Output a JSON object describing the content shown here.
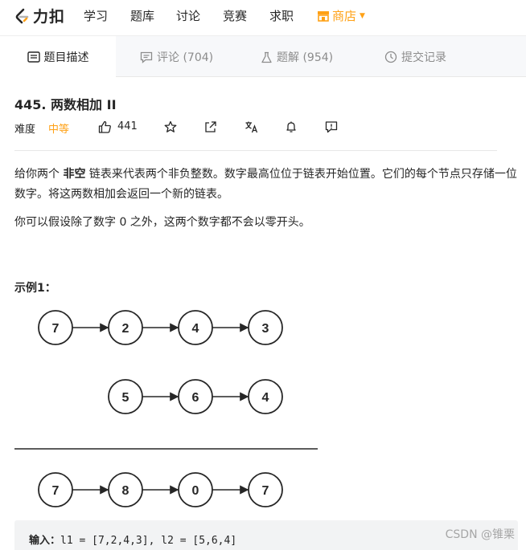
{
  "nav": {
    "logo_text": "力扣",
    "links": [
      "学习",
      "题库",
      "讨论",
      "竞赛",
      "求职"
    ],
    "store_label": "商店"
  },
  "tabs": [
    {
      "label": "题目描述",
      "icon": "description-icon",
      "active": true
    },
    {
      "label": "评论 (704)",
      "icon": "comment-icon",
      "active": false
    },
    {
      "label": "题解 (954)",
      "icon": "flask-icon",
      "active": false
    },
    {
      "label": "提交记录",
      "icon": "clock-icon",
      "active": false
    }
  ],
  "problem": {
    "title": "445. 两数相加 II",
    "difficulty_label": "难度",
    "difficulty": "中等",
    "likes": "441"
  },
  "description": {
    "p1_before": "给你两个 ",
    "p1_bold": "非空",
    "p1_after": " 链表来代表两个非负整数。数字最高位位于链表开始位置。它们的每个节点只存储一位数字。将这两数相加会返回一个新的链表。",
    "p2": "你可以假设除了数字 0 之外，这两个数字都不会以零开头。"
  },
  "example": {
    "title": "示例1：",
    "list1": [
      "7",
      "2",
      "4",
      "3"
    ],
    "list2": [
      "5",
      "6",
      "4"
    ],
    "result": [
      "7",
      "8",
      "0",
      "7"
    ],
    "input_label": "输入：",
    "input_value": "l1 = [7,2,4,3], l2 = [5,6,4]"
  },
  "watermark": "CSDN @锥栗",
  "colors": {
    "accent": "#ffa116",
    "text": "#262626",
    "muted": "#8c8c8c"
  }
}
